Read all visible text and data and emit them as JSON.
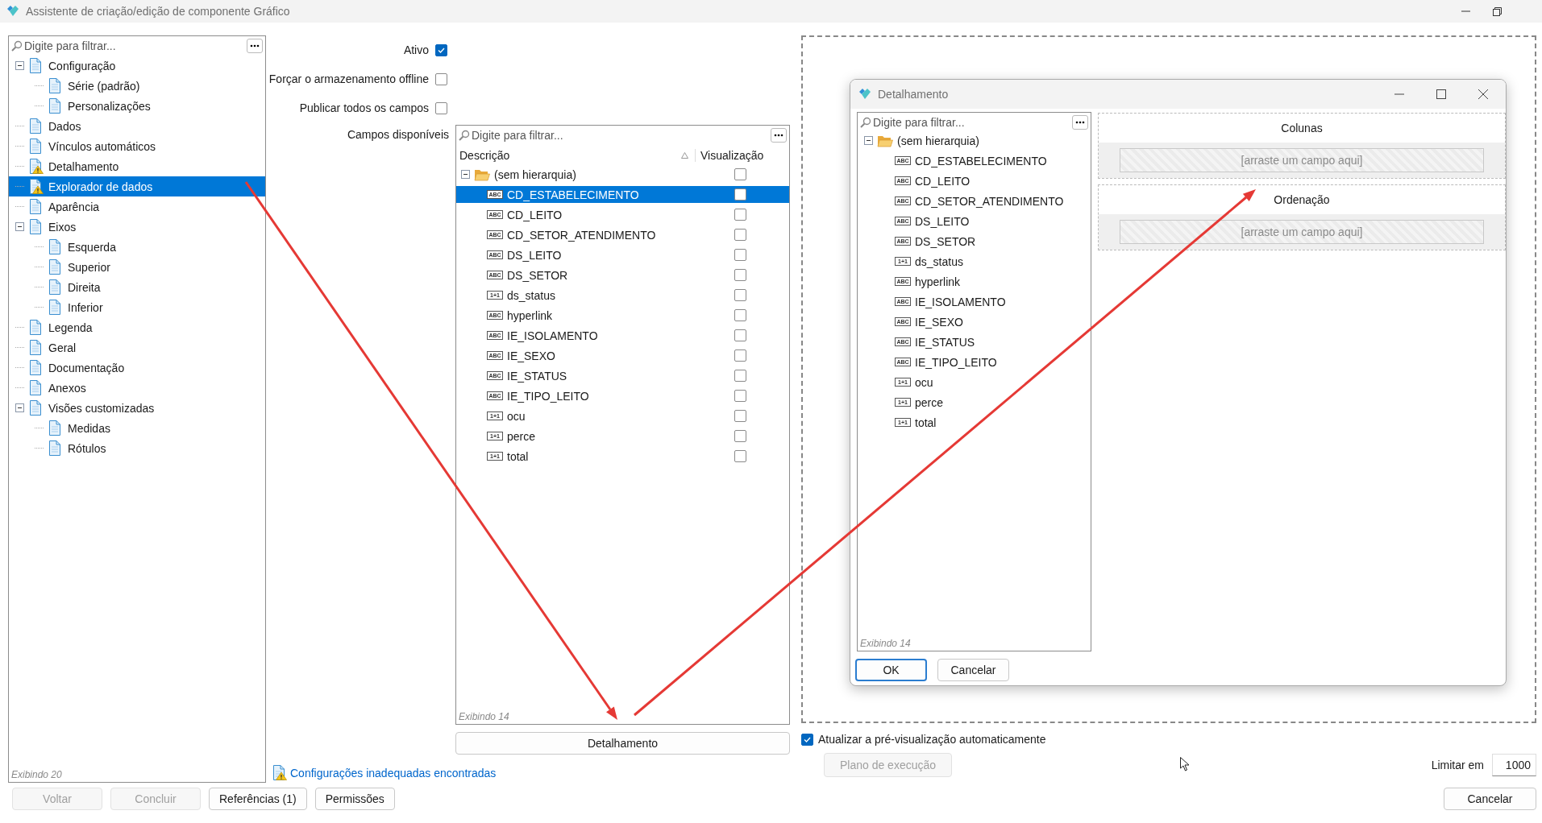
{
  "window": {
    "title": "Assistente de criação/edição de componente Gráfico"
  },
  "sidebar": {
    "placeholder": "Digite para filtrar...",
    "footer": "Exibindo 20",
    "items": [
      {
        "label": "Configuração",
        "warning": false,
        "selected": false,
        "expanded": true,
        "children": [
          {
            "label": "Série (padrão)",
            "warning": false,
            "selected": false
          },
          {
            "label": "Personalizações",
            "warning": false,
            "selected": false
          }
        ]
      },
      {
        "label": "Dados",
        "warning": false,
        "selected": false
      },
      {
        "label": "Vínculos automáticos",
        "warning": false,
        "selected": false
      },
      {
        "label": "Detalhamento",
        "warning": true,
        "selected": false
      },
      {
        "label": "Explorador de dados",
        "warning": true,
        "selected": true
      },
      {
        "label": "Aparência",
        "warning": false,
        "selected": false
      },
      {
        "label": "Eixos",
        "warning": false,
        "selected": false,
        "expanded": true,
        "children": [
          {
            "label": "Esquerda",
            "warning": false,
            "selected": false
          },
          {
            "label": "Superior",
            "warning": false,
            "selected": false
          },
          {
            "label": "Direita",
            "warning": false,
            "selected": false
          },
          {
            "label": "Inferior",
            "warning": false,
            "selected": false
          }
        ]
      },
      {
        "label": "Legenda",
        "warning": false,
        "selected": false
      },
      {
        "label": "Geral",
        "warning": false,
        "selected": false
      },
      {
        "label": "Documentação",
        "warning": false,
        "selected": false
      },
      {
        "label": "Anexos",
        "warning": false,
        "selected": false
      },
      {
        "label": "Visões customizadas",
        "warning": false,
        "selected": false,
        "expanded": true,
        "children": [
          {
            "label": "Medidas",
            "warning": false,
            "selected": false
          },
          {
            "label": "Rótulos",
            "warning": false,
            "selected": false
          }
        ]
      }
    ]
  },
  "options": [
    {
      "label": "Ativo",
      "checked": true
    },
    {
      "label": "Forçar o armazenamento offline",
      "checked": false
    },
    {
      "label": "Publicar todos os campos",
      "checked": false
    }
  ],
  "fields": {
    "label": "Campos disponíveis",
    "placeholder": "Digite para filtrar...",
    "columns": [
      "Descrição",
      "Visualização"
    ],
    "footer": "Exibindo 14",
    "group": {
      "label": "(sem hierarquia)",
      "expanded": true,
      "checked": false,
      "children": [
        {
          "name": "CD_ESTABELECIMENTO",
          "type_label": "ABC",
          "selected": true,
          "checked": false
        },
        {
          "name": "CD_LEITO",
          "type_label": "ABC",
          "selected": false,
          "checked": false
        },
        {
          "name": "CD_SETOR_ATENDIMENTO",
          "type_label": "ABC",
          "selected": false,
          "checked": false
        },
        {
          "name": "DS_LEITO",
          "type_label": "ABC",
          "selected": false,
          "checked": false
        },
        {
          "name": "DS_SETOR",
          "type_label": "ABC",
          "selected": false,
          "checked": false
        },
        {
          "name": "ds_status",
          "type_label": "1+1",
          "selected": false,
          "checked": false
        },
        {
          "name": "hyperlink",
          "type_label": "ABC",
          "selected": false,
          "checked": false
        },
        {
          "name": "IE_ISOLAMENTO",
          "type_label": "ABC",
          "selected": false,
          "checked": false
        },
        {
          "name": "IE_SEXO",
          "type_label": "ABC",
          "selected": false,
          "checked": false
        },
        {
          "name": "IE_STATUS",
          "type_label": "ABC",
          "selected": false,
          "checked": false
        },
        {
          "name": "IE_TIPO_LEITO",
          "type_label": "ABC",
          "selected": false,
          "checked": false
        },
        {
          "name": "ocu",
          "type_label": "1+1",
          "selected": false,
          "checked": false
        },
        {
          "name": "perce",
          "type_label": "1+1",
          "selected": false,
          "checked": false
        },
        {
          "name": "total",
          "type_label": "1+1",
          "selected": false,
          "checked": false
        }
      ]
    }
  },
  "detail_button": "Detalhamento",
  "warning_link": "Configurações inadequadas encontradas",
  "auto_preview": {
    "label": "Atualizar a pré-visualização automaticamente",
    "checked": true
  },
  "execution_plan_button": {
    "label": "Plano de execução",
    "disabled": true
  },
  "limit": {
    "label": "Limitar em",
    "value": "1000"
  },
  "buttons": [
    {
      "label": "Voltar",
      "disabled": true
    },
    {
      "label": "Concluir",
      "disabled": true
    },
    {
      "label": "Referências (1)",
      "disabled": false
    },
    {
      "label": "Permissões",
      "disabled": false
    }
  ],
  "cancel_button": {
    "label": "Cancelar",
    "disabled": false
  },
  "dialog": {
    "title": "Detalhamento",
    "placeholder": "Digite para filtrar...",
    "footer": "Exibindo 14",
    "group": {
      "label": "(sem hierarquia)",
      "expanded": true,
      "children": [
        {
          "name": "CD_ESTABELECIMENTO",
          "type_label": "ABC"
        },
        {
          "name": "CD_LEITO",
          "type_label": "ABC"
        },
        {
          "name": "CD_SETOR_ATENDIMENTO",
          "type_label": "ABC"
        },
        {
          "name": "DS_LEITO",
          "type_label": "ABC"
        },
        {
          "name": "DS_SETOR",
          "type_label": "ABC"
        },
        {
          "name": "ds_status",
          "type_label": "1+1"
        },
        {
          "name": "hyperlink",
          "type_label": "ABC"
        },
        {
          "name": "IE_ISOLAMENTO",
          "type_label": "ABC"
        },
        {
          "name": "IE_SEXO",
          "type_label": "ABC"
        },
        {
          "name": "IE_STATUS",
          "type_label": "ABC"
        },
        {
          "name": "IE_TIPO_LEITO",
          "type_label": "ABC"
        },
        {
          "name": "ocu",
          "type_label": "1+1"
        },
        {
          "name": "perce",
          "type_label": "1+1"
        },
        {
          "name": "total",
          "type_label": "1+1"
        }
      ]
    },
    "sections": [
      {
        "title": "Colunas",
        "placeholder": "[arraste um campo aqui]"
      },
      {
        "title": "Ordenação",
        "placeholder": "[arraste um campo aqui]"
      }
    ],
    "buttons": [
      {
        "label": "OK",
        "default": true
      },
      {
        "label": "Cancelar",
        "default": false
      }
    ]
  }
}
